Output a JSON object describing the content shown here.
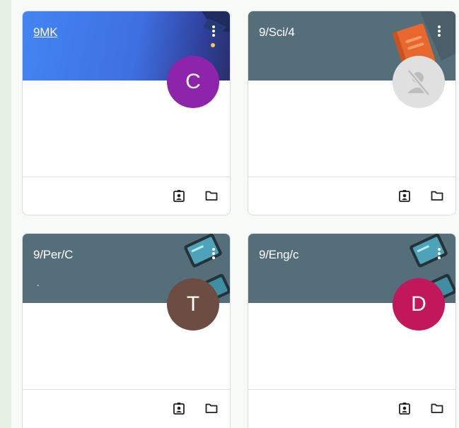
{
  "cards": [
    {
      "title": "9MK",
      "subtitle": "",
      "header_color": "#4285f4",
      "avatar_letter": "C",
      "avatar_color": "#8e24aa",
      "avatar_icon": ""
    },
    {
      "title": "9/Sci/4",
      "subtitle": "",
      "header_color": "#546e7a",
      "avatar_letter": "",
      "avatar_color": "#e0e0e0",
      "avatar_icon": "no-photo-person-icon"
    },
    {
      "title": "9/Per/C",
      "subtitle": "-",
      "header_color": "#546e7a",
      "avatar_letter": "T",
      "avatar_color": "#6d4c41",
      "avatar_icon": ""
    },
    {
      "title": "9/Eng/c",
      "subtitle": "",
      "header_color": "#546e7a",
      "avatar_letter": "D",
      "avatar_color": "#c2185b",
      "avatar_icon": ""
    }
  ],
  "icons": {
    "menu": "more-vert-icon",
    "portfolio": "assignment-ind-icon",
    "folder": "folder-icon"
  }
}
